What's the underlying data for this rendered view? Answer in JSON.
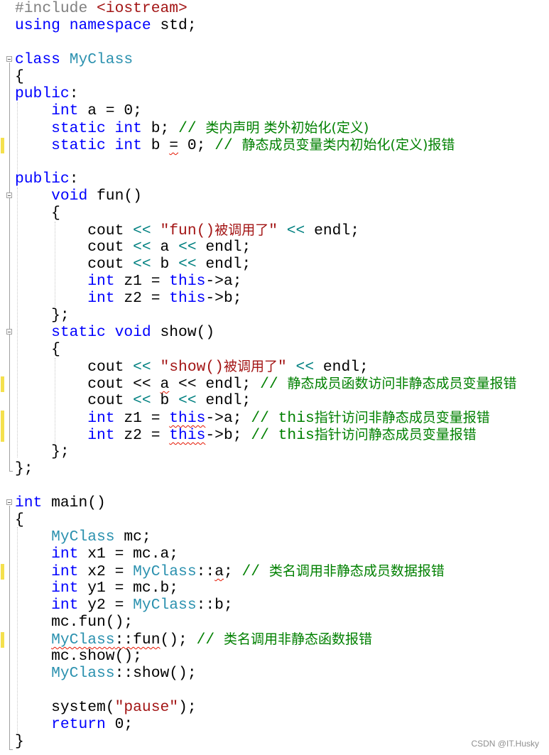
{
  "editor": {
    "language": "C++",
    "lines": {
      "l1": {
        "pp": "#include ",
        "inc": "<iostream>"
      },
      "l2": {
        "kw1": "using",
        "sp1": " ",
        "kw2": "namespace",
        "rest": " std;"
      },
      "l4": {
        "kw": "class",
        "sp": " ",
        "ty": "MyClass"
      },
      "l5": {
        "text": "{"
      },
      "l6": {
        "kw": "public",
        "rest": ":"
      },
      "l7": {
        "indent": "    ",
        "kw": "int",
        "rest": " a = 0;"
      },
      "l8": {
        "indent": "    ",
        "kw1": "static",
        "sp1": " ",
        "kw2": "int",
        "rest": " b; ",
        "cm": "// ",
        "cmcjk": "类内声明 类外初始化(定义)"
      },
      "l9": {
        "indent": "    ",
        "kw1": "static",
        "sp1": " ",
        "kw2": "int",
        "rest1": " b ",
        "err": "=",
        "rest2": " 0; ",
        "cm": "// ",
        "cmcjk": "静态成员变量类内初始化(定义)报错"
      },
      "l11": {
        "kw": "public",
        "rest": ":"
      },
      "l12": {
        "indent": "    ",
        "kw": "void",
        "rest": " fun()"
      },
      "l13": {
        "indent": "    ",
        "text": "{"
      },
      "l14": {
        "indent": "        ",
        "a": "cout ",
        "op1": "<<",
        "sp": " ",
        "st": "\"fun()",
        "stcjk": "被调用了",
        "st2": "\"",
        "sp2": " ",
        "op2": "<<",
        "rest": " endl;"
      },
      "l15": {
        "indent": "        ",
        "a": "cout ",
        "op1": "<<",
        "mid": " a ",
        "op2": "<<",
        "rest": " endl;"
      },
      "l16": {
        "indent": "        ",
        "a": "cout ",
        "op1": "<<",
        "mid": " b ",
        "op2": "<<",
        "rest": " endl;"
      },
      "l17": {
        "indent": "        ",
        "kw": "int",
        "mid": " z1 = ",
        "kw2": "this",
        "rest": "->a;"
      },
      "l18": {
        "indent": "        ",
        "kw": "int",
        "mid": " z2 = ",
        "kw2": "this",
        "rest": "->b;"
      },
      "l19": {
        "indent": "    ",
        "text": "};"
      },
      "l20": {
        "indent": "    ",
        "kw1": "static",
        "sp1": " ",
        "kw2": "void",
        "rest": " show()"
      },
      "l21": {
        "indent": "    ",
        "text": "{"
      },
      "l22": {
        "indent": "        ",
        "a": "cout ",
        "op1": "<<",
        "sp": " ",
        "st": "\"show()",
        "stcjk": "被调用了",
        "st2": "\"",
        "sp2": " ",
        "op2": "<<",
        "rest": " endl;"
      },
      "l23": {
        "indent": "        ",
        "a": "cout << ",
        "err": "a",
        "rest": " << endl; ",
        "cm": "// ",
        "cmcjk": "静态成员函数访问非静态成员变量报错"
      },
      "l24": {
        "indent": "        ",
        "a": "cout ",
        "op1": "<<",
        "mid": " b ",
        "op2": "<<",
        "rest": " endl;"
      },
      "l25": {
        "indent": "        ",
        "kw": "int",
        "mid": " z1 = ",
        "err": "this",
        "rest": "->a; ",
        "cm": "// this",
        "cmcjk": "指针访问非静态成员变量报错"
      },
      "l26": {
        "indent": "        ",
        "kw": "int",
        "mid": " z2 = ",
        "err": "this",
        "rest": "->b; ",
        "cm": "// this",
        "cmcjk": "指针访问静态成员变量报错"
      },
      "l27": {
        "indent": "    ",
        "text": "};"
      },
      "l28": {
        "text": "};"
      },
      "l30": {
        "kw": "int",
        "rest": " main()"
      },
      "l31": {
        "text": "{"
      },
      "l32": {
        "indent": "    ",
        "ty": "MyClass",
        "rest": " mc;"
      },
      "l33": {
        "indent": "    ",
        "kw": "int",
        "rest": " x1 = mc.a;"
      },
      "l34": {
        "indent": "    ",
        "kw": "int",
        "mid": " x2 = ",
        "ty": "MyClass",
        "mid2": "::",
        "err": "a",
        "rest": "; ",
        "cm": "// ",
        "cmcjk": "类名调用非静态成员数据报错"
      },
      "l35": {
        "indent": "    ",
        "kw": "int",
        "rest": " y1 = mc.b;"
      },
      "l36": {
        "indent": "    ",
        "kw": "int",
        "mid": " y2 = ",
        "ty": "MyClass",
        "rest": "::b;"
      },
      "l37": {
        "indent": "    ",
        "text": "mc.fun();"
      },
      "l38": {
        "indent": "    ",
        "errty": "MyClass",
        "err": "::fun",
        "rest": "(); ",
        "cm": "// ",
        "cmcjk": "类名调用非静态函数报错"
      },
      "l39": {
        "indent": "    ",
        "text": "mc.show();"
      },
      "l40": {
        "indent": "    ",
        "ty": "MyClass",
        "rest": "::show();"
      },
      "l42": {
        "indent": "    ",
        "a": "system(",
        "st": "\"pause\"",
        "rest": ");"
      },
      "l43": {
        "indent": "    ",
        "kw": "return",
        "rest": " 0;"
      },
      "l44": {
        "text": "}"
      }
    }
  },
  "watermark": "CSDN @IT.Husky"
}
